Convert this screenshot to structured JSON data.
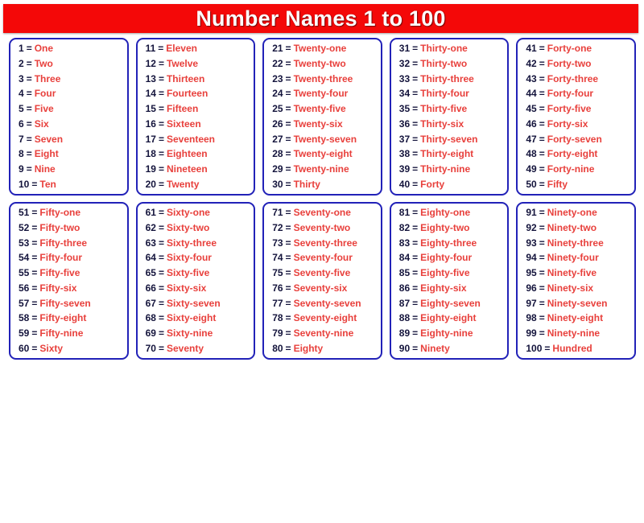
{
  "title": "Number Names 1 to 100",
  "colors": {
    "banner_background": "#f40808",
    "banner_text": "#ffffff",
    "box_border": "#2222b8",
    "numeral_text": "#14143c",
    "word_text": "#e8403c",
    "page_background": "#ffffff"
  },
  "equals_sign": "=",
  "boxes": [
    {
      "box_name": "numbers-1-to-10",
      "entries": [
        {
          "number": "1",
          "word": "One"
        },
        {
          "number": "2",
          "word": "Two"
        },
        {
          "number": "3",
          "word": "Three"
        },
        {
          "number": "4",
          "word": "Four"
        },
        {
          "number": "5",
          "word": "Five"
        },
        {
          "number": "6",
          "word": "Six"
        },
        {
          "number": "7",
          "word": "Seven"
        },
        {
          "number": "8",
          "word": "Eight"
        },
        {
          "number": "9",
          "word": "Nine"
        },
        {
          "number": "10",
          "word": "Ten"
        }
      ]
    },
    {
      "box_name": "numbers-11-to-20",
      "entries": [
        {
          "number": "11",
          "word": "Eleven"
        },
        {
          "number": "12",
          "word": "Twelve"
        },
        {
          "number": "13",
          "word": "Thirteen"
        },
        {
          "number": "14",
          "word": "Fourteen"
        },
        {
          "number": "15",
          "word": "Fifteen"
        },
        {
          "number": "16",
          "word": "Sixteen"
        },
        {
          "number": "17",
          "word": "Seventeen"
        },
        {
          "number": "18",
          "word": "Eighteen"
        },
        {
          "number": "19",
          "word": "Nineteen"
        },
        {
          "number": "20",
          "word": "Twenty"
        }
      ]
    },
    {
      "box_name": "numbers-21-to-30",
      "entries": [
        {
          "number": "21",
          "word": "Twenty-one"
        },
        {
          "number": "22",
          "word": "Twenty-two"
        },
        {
          "number": "23",
          "word": "Twenty-three"
        },
        {
          "number": "24",
          "word": "Twenty-four"
        },
        {
          "number": "25",
          "word": "Twenty-five"
        },
        {
          "number": "26",
          "word": "Twenty-six"
        },
        {
          "number": "27",
          "word": "Twenty-seven"
        },
        {
          "number": "28",
          "word": "Twenty-eight"
        },
        {
          "number": "29",
          "word": "Twenty-nine"
        },
        {
          "number": "30",
          "word": "Thirty"
        }
      ]
    },
    {
      "box_name": "numbers-31-to-40",
      "entries": [
        {
          "number": "31",
          "word": "Thirty-one"
        },
        {
          "number": "32",
          "word": "Thirty-two"
        },
        {
          "number": "33",
          "word": "Thirty-three"
        },
        {
          "number": "34",
          "word": "Thirty-four"
        },
        {
          "number": "35",
          "word": "Thirty-five"
        },
        {
          "number": "36",
          "word": "Thirty-six"
        },
        {
          "number": "37",
          "word": "Thirty-seven"
        },
        {
          "number": "38",
          "word": "Thirty-eight"
        },
        {
          "number": "39",
          "word": "Thirty-nine"
        },
        {
          "number": "40",
          "word": "Forty"
        }
      ]
    },
    {
      "box_name": "numbers-41-to-50",
      "entries": [
        {
          "number": "41",
          "word": "Forty-one"
        },
        {
          "number": "42",
          "word": "Forty-two"
        },
        {
          "number": "43",
          "word": "Forty-three"
        },
        {
          "number": "44",
          "word": "Forty-four"
        },
        {
          "number": "45",
          "word": "Forty-five"
        },
        {
          "number": "46",
          "word": "Forty-six"
        },
        {
          "number": "47",
          "word": "Forty-seven"
        },
        {
          "number": "48",
          "word": "Forty-eight"
        },
        {
          "number": "49",
          "word": "Forty-nine"
        },
        {
          "number": "50",
          "word": "Fifty"
        }
      ]
    },
    {
      "box_name": "numbers-51-to-60",
      "entries": [
        {
          "number": "51",
          "word": "Fifty-one"
        },
        {
          "number": "52",
          "word": "Fifty-two"
        },
        {
          "number": "53",
          "word": "Fifty-three"
        },
        {
          "number": "54",
          "word": "Fifty-four"
        },
        {
          "number": "55",
          "word": "Fifty-five"
        },
        {
          "number": "56",
          "word": "Fifty-six"
        },
        {
          "number": "57",
          "word": "Fifty-seven"
        },
        {
          "number": "58",
          "word": "Fifty-eight"
        },
        {
          "number": "59",
          "word": "Fifty-nine"
        },
        {
          "number": "60",
          "word": "Sixty"
        }
      ]
    },
    {
      "box_name": "numbers-61-to-70",
      "entries": [
        {
          "number": "61",
          "word": "Sixty-one"
        },
        {
          "number": "62",
          "word": "Sixty-two"
        },
        {
          "number": "63",
          "word": "Sixty-three"
        },
        {
          "number": "64",
          "word": "Sixty-four"
        },
        {
          "number": "65",
          "word": "Sixty-five"
        },
        {
          "number": "66",
          "word": "Sixty-six"
        },
        {
          "number": "67",
          "word": "Sixty-seven"
        },
        {
          "number": "68",
          "word": "Sixty-eight"
        },
        {
          "number": "69",
          "word": "Sixty-nine"
        },
        {
          "number": "70",
          "word": "Seventy"
        }
      ]
    },
    {
      "box_name": "numbers-71-to-80",
      "entries": [
        {
          "number": "71",
          "word": "Seventy-one"
        },
        {
          "number": "72",
          "word": "Seventy-two"
        },
        {
          "number": "73",
          "word": "Seventy-three"
        },
        {
          "number": "74",
          "word": "Seventy-four"
        },
        {
          "number": "75",
          "word": "Seventy-five"
        },
        {
          "number": "76",
          "word": "Seventy-six"
        },
        {
          "number": "77",
          "word": "Seventy-seven"
        },
        {
          "number": "78",
          "word": "Seventy-eight"
        },
        {
          "number": "79",
          "word": "Seventy-nine"
        },
        {
          "number": "80",
          "word": "Eighty"
        }
      ]
    },
    {
      "box_name": "numbers-81-to-90",
      "entries": [
        {
          "number": "81",
          "word": "Eighty-one"
        },
        {
          "number": "82",
          "word": "Eighty-two"
        },
        {
          "number": "83",
          "word": "Eighty-three"
        },
        {
          "number": "84",
          "word": "Eighty-four"
        },
        {
          "number": "85",
          "word": "Eighty-five"
        },
        {
          "number": "86",
          "word": "Eighty-six"
        },
        {
          "number": "87",
          "word": "Eighty-seven"
        },
        {
          "number": "88",
          "word": "Eighty-eight"
        },
        {
          "number": "89",
          "word": "Eighty-nine"
        },
        {
          "number": "90",
          "word": "Ninety"
        }
      ]
    },
    {
      "box_name": "numbers-91-to-100",
      "entries": [
        {
          "number": "91",
          "word": "Ninety-one"
        },
        {
          "number": "92",
          "word": "Ninety-two"
        },
        {
          "number": "93",
          "word": "Ninety-three"
        },
        {
          "number": "94",
          "word": "Ninety-four"
        },
        {
          "number": "95",
          "word": "Ninety-five"
        },
        {
          "number": "96",
          "word": "Ninety-six"
        },
        {
          "number": "97",
          "word": "Ninety-seven"
        },
        {
          "number": "98",
          "word": "Ninety-eight"
        },
        {
          "number": "99",
          "word": "Ninety-nine"
        },
        {
          "number": "100",
          "word": "Hundred"
        }
      ]
    }
  ]
}
